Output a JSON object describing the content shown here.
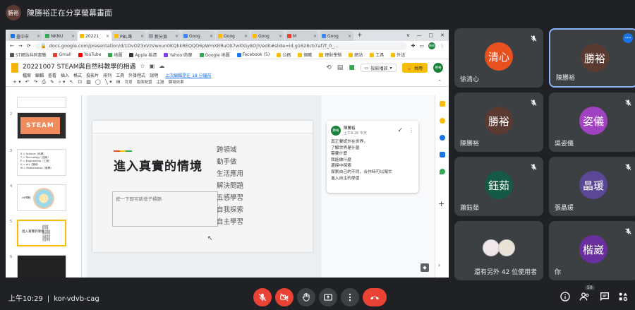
{
  "presenter_banner": {
    "avatar": "勝裕",
    "text": "陳勝裕正在分享螢幕畫面"
  },
  "browser": {
    "tabs": [
      {
        "label": "臺中市",
        "color": "#1a73e8"
      },
      {
        "label": "NKNU",
        "color": "#34a853"
      },
      {
        "label": "20221",
        "color": "#fbbc04",
        "active": true
      },
      {
        "label": "PBL專",
        "color": "#fbbc04"
      },
      {
        "label": "新分頁",
        "color": "#9aa0a6"
      },
      {
        "label": "Goog",
        "color": "#4285f4"
      },
      {
        "label": "Goog",
        "color": "#fbbc04"
      },
      {
        "label": "Goog",
        "color": "#fbbc04"
      },
      {
        "label": "M",
        "color": "#ea4335"
      },
      {
        "label": "Goog",
        "color": "#4285f4"
      }
    ],
    "new_tab": "+",
    "window_controls": [
      "v",
      "—",
      "□",
      "✕"
    ],
    "url": "docs.google.com/presentation/d/1DvOZ3xVzVwxun0KQhkREQQO6pWmXRRuOX7wl0Gy8OjY/edit#slide=id.g1628cb7af7f_0_...",
    "profile": "勝裕",
    "bookmarks": [
      "ST網站共同書籤",
      "Gmail",
      "YouTube",
      "地圖",
      "Apple 裕清",
      "Yahoo!奇摩",
      "Google 地圖",
      "Facebook (5)",
      "公務",
      "個職",
      "理財學騎",
      "網站",
      "工具",
      "外送"
    ]
  },
  "docs": {
    "title": "20221007 STEAM與自然科教學的相遇",
    "menu": [
      "檔案",
      "編輯",
      "查看",
      "插入",
      "格式",
      "投影片",
      "排列",
      "工具",
      "外掛程式",
      "說明"
    ],
    "last_edit": "上次編輯是在 18 分鐘前",
    "present_label": "投影播放",
    "share_label": "共用",
    "avatar": "勝裕",
    "toolbar_text": [
      "背景",
      "版面配置",
      "主題",
      "轉場效果"
    ]
  },
  "filmstrip": {
    "slides": [
      {
        "num": "",
        "kind": "blank"
      },
      {
        "num": "2",
        "kind": "stem",
        "text": "STEAM"
      },
      {
        "num": "3",
        "kind": "text",
        "lines": [
          "S = Science（科學）",
          "T = Technology（技術）",
          "E = Engineering（工程）",
          "A = Art（藝術）",
          "M = Mathematics（數學）"
        ]
      },
      {
        "num": "4",
        "kind": "circle",
        "text": "sdf課程"
      },
      {
        "num": "5",
        "kind": "selected",
        "text": "進入真實的情境"
      },
      {
        "num": "6",
        "kind": "dark"
      }
    ]
  },
  "slide": {
    "title": "進入真實的情境",
    "subtitle_placeholder": "按一下即可新增子標題",
    "list": [
      "跨領域",
      "動手做",
      "生活應用",
      "解決問題",
      "五感學習",
      "自我探索",
      "自主學習"
    ]
  },
  "comment": {
    "avatar": "勝裕",
    "author": "陳勝裕",
    "time": "上午9:26 今天",
    "lines": [
      "真正要認外在世界，",
      "了解世界是什麼",
      "需要什麼",
      "我能做什麼",
      "邊探中探索",
      "探索自己的不同，合作時可以幫忙",
      "進入自主的學習"
    ]
  },
  "participants": [
    {
      "name": "徐清心",
      "avatar": "清心",
      "color": "#e8501f",
      "muted": true
    },
    {
      "name": "陳勝裕",
      "avatar": "勝裕",
      "color": "#5b3b31",
      "muted": false,
      "highlighted": true
    },
    {
      "name": "陳勝裕",
      "avatar": "勝裕",
      "color": "#5b3b31",
      "muted": true
    },
    {
      "name": "吳姿儀",
      "avatar": "姿儀",
      "color": "#a142c2",
      "muted": true
    },
    {
      "name": "蕭鈺茹",
      "avatar": "鈺茹",
      "color": "#155a45",
      "muted": true
    },
    {
      "name": "張晶瑗",
      "avatar": "晶瑗",
      "color": "#5a4795",
      "muted": true
    },
    {
      "name": "還有另外 42 位使用者",
      "avatar": "",
      "color": "",
      "muted": false,
      "others": true
    },
    {
      "name": "你",
      "avatar": "楷崴",
      "color": "#6a2f9e",
      "muted": true
    }
  ],
  "bottom_bar": {
    "time": "上午10:29",
    "separator": "|",
    "meeting_code": "kor-vdvb-cag",
    "people_count": "50"
  },
  "colors": {
    "bg": "#202124",
    "tile": "#3c4043",
    "red": "#ea4335",
    "highlight": "#8ab4f8"
  }
}
